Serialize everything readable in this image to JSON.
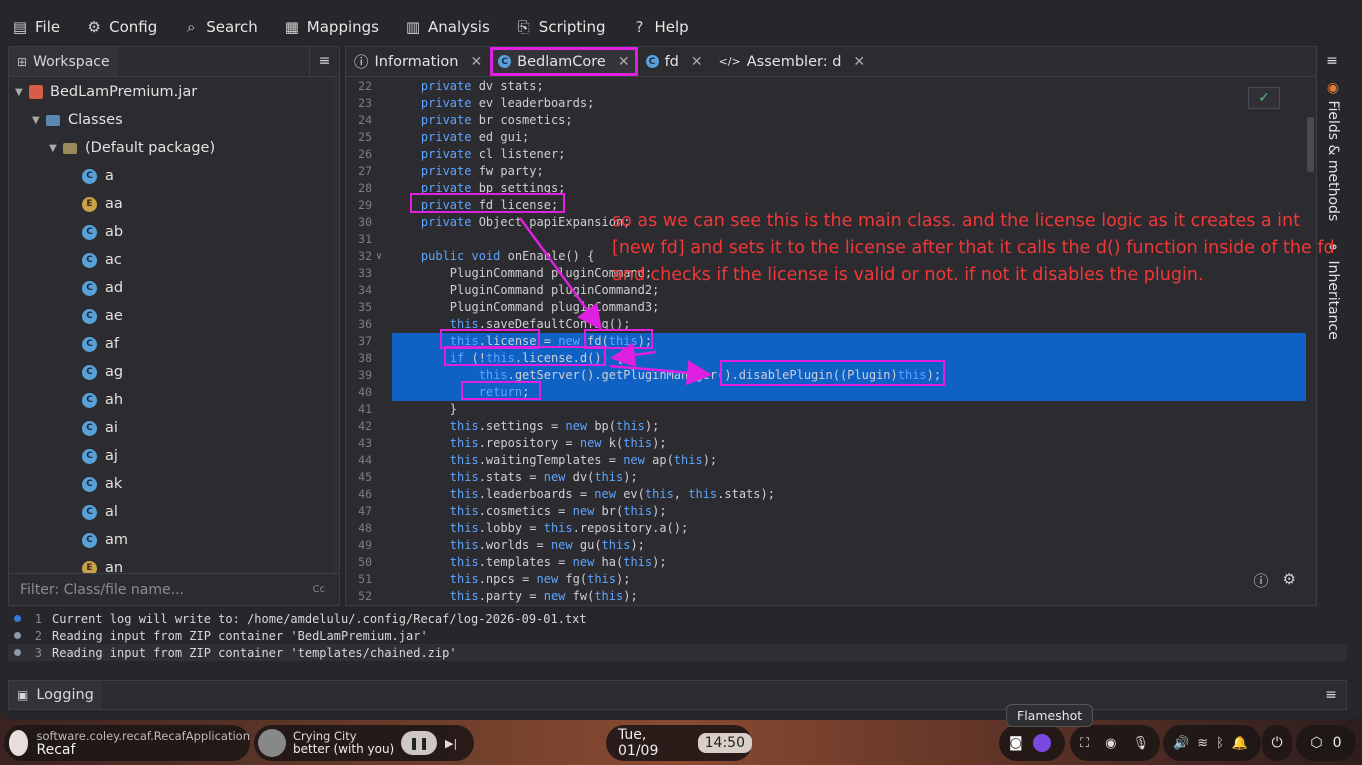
{
  "menu": [
    {
      "icon": "file-icon",
      "glyph": "▤",
      "label": "File"
    },
    {
      "icon": "gear-icon",
      "glyph": "⚙",
      "label": "Config"
    },
    {
      "icon": "search-icon",
      "glyph": "⌕",
      "label": "Search"
    },
    {
      "icon": "mappings-icon",
      "glyph": "▦",
      "label": "Mappings"
    },
    {
      "icon": "analysis-icon",
      "glyph": "▥",
      "label": "Analysis"
    },
    {
      "icon": "scripting-icon",
      "glyph": "⎘",
      "label": "Scripting"
    },
    {
      "icon": "help-icon",
      "glyph": "?",
      "label": "Help"
    }
  ],
  "workspace": {
    "tab_label": "Workspace",
    "jar": "BedLamPremium.jar",
    "classes_label": "Classes",
    "package_label": "(Default package)",
    "classes": [
      {
        "name": "a",
        "kind": "C"
      },
      {
        "name": "aa",
        "kind": "E"
      },
      {
        "name": "ab",
        "kind": "C"
      },
      {
        "name": "ac",
        "kind": "C"
      },
      {
        "name": "ad",
        "kind": "C"
      },
      {
        "name": "ae",
        "kind": "C"
      },
      {
        "name": "af",
        "kind": "C"
      },
      {
        "name": "ag",
        "kind": "C"
      },
      {
        "name": "ah",
        "kind": "C"
      },
      {
        "name": "ai",
        "kind": "C"
      },
      {
        "name": "aj",
        "kind": "C"
      },
      {
        "name": "ak",
        "kind": "C"
      },
      {
        "name": "al",
        "kind": "C"
      },
      {
        "name": "am",
        "kind": "C"
      },
      {
        "name": "an",
        "kind": "E"
      }
    ],
    "filter_placeholder": "Filter: Class/file name...",
    "filter_hint": "Cc"
  },
  "editor": {
    "tabs": [
      {
        "icon": "info-icon",
        "label": "Information",
        "active": false
      },
      {
        "icon": "class-icon",
        "label": "BedlamCore",
        "active": true
      },
      {
        "icon": "class-icon",
        "label": "fd",
        "active": false
      },
      {
        "icon": "code-icon",
        "label": "Assembler: d",
        "active": false
      }
    ],
    "lines": [
      {
        "n": "22",
        "code": "    private dv stats;"
      },
      {
        "n": "23",
        "code": "    private ev leaderboards;"
      },
      {
        "n": "24",
        "code": "    private br cosmetics;"
      },
      {
        "n": "25",
        "code": "    private ed gui;"
      },
      {
        "n": "26",
        "code": "    private cl listener;"
      },
      {
        "n": "27",
        "code": "    private fw party;"
      },
      {
        "n": "28",
        "code": "    private bp settings;"
      },
      {
        "n": "29",
        "code": "    private fd license;"
      },
      {
        "n": "30",
        "code": "    private Object papiExpansion;"
      },
      {
        "n": "31",
        "code": ""
      },
      {
        "n": "32",
        "code": "    public void onEnable() {"
      },
      {
        "n": "33",
        "code": "        PluginCommand pluginCommand;"
      },
      {
        "n": "34",
        "code": "        PluginCommand pluginCommand2;"
      },
      {
        "n": "35",
        "code": "        PluginCommand pluginCommand3;"
      },
      {
        "n": "36",
        "code": "        this.saveDefaultConfig();"
      },
      {
        "n": "37",
        "code": "        this.license = new fd(this);"
      },
      {
        "n": "38",
        "code": "        if (!this.license.d()) {"
      },
      {
        "n": "39",
        "code": "            this.getServer().getPluginManager().disablePlugin((Plugin)this);"
      },
      {
        "n": "40",
        "code": "            return;"
      },
      {
        "n": "41",
        "code": "        }"
      },
      {
        "n": "42",
        "code": "        this.settings = new bp(this);"
      },
      {
        "n": "43",
        "code": "        this.repository = new k(this);"
      },
      {
        "n": "44",
        "code": "        this.waitingTemplates = new ap(this);"
      },
      {
        "n": "45",
        "code": "        this.stats = new dv(this);"
      },
      {
        "n": "46",
        "code": "        this.leaderboards = new ev(this, this.stats);"
      },
      {
        "n": "47",
        "code": "        this.cosmetics = new br(this);"
      },
      {
        "n": "48",
        "code": "        this.lobby = this.repository.a();"
      },
      {
        "n": "49",
        "code": "        this.worlds = new gu(this);"
      },
      {
        "n": "50",
        "code": "        this.templates = new ha(this);"
      },
      {
        "n": "51",
        "code": "        this.npcs = new fg(this);"
      },
      {
        "n": "52",
        "code": "        this.party = new fw(this);"
      }
    ],
    "right_tabs": [
      "Fields & methods",
      "Inheritance"
    ]
  },
  "annotation": "so as we can see this is the main class. and the license logic as it creates a int [new fd] and sets it to the license after that it calls the d() function inside of the fd and checks if the license is valid or not. if not it disables the plugin.",
  "log": {
    "lines": [
      {
        "n": "1",
        "text": "Current log will write to: /home/amdelulu/.config/Recaf/log-2026-09-01.txt",
        "color": "#3a78d8"
      },
      {
        "n": "2",
        "text": "Reading input from ZIP container 'BedLamPremium.jar'",
        "color": "#8a9aa8"
      },
      {
        "n": "3",
        "text": "Reading input from ZIP container 'templates/chained.zip'",
        "color": "#8a9aa8"
      }
    ],
    "tab_label": "Logging"
  },
  "taskbar": {
    "app_class": "software.coley.recaf.RecafApplication",
    "app_name": "Recaf",
    "media_title": "Crying City",
    "media_subtitle": "better (with you)",
    "date": "Tue, 01/09",
    "time": "14:50",
    "tooltip": "Flameshot",
    "notif_count": "0"
  },
  "colors": {
    "annotation": "#f03838",
    "highlight": "#e020e0",
    "selection": "#0f62c4",
    "keyword": "#5ea4ff"
  }
}
